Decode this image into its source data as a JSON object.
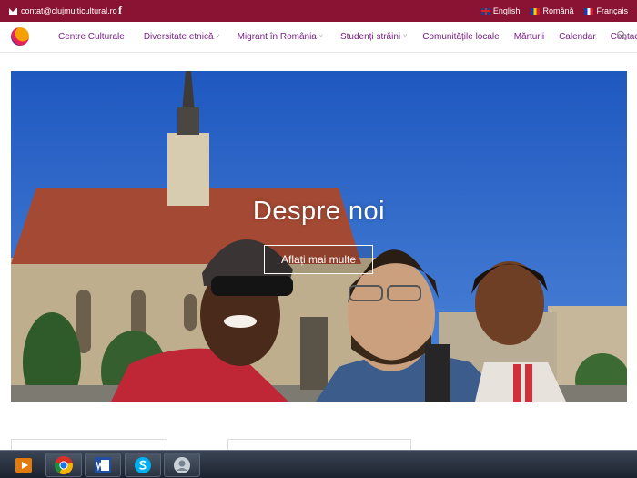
{
  "topbar": {
    "email": "contat@clujmulticultural.ro",
    "facebook": "f",
    "languages": [
      {
        "label": "English",
        "flag": "uk-flag-icon"
      },
      {
        "label": "Română",
        "flag": "romania-flag-icon"
      },
      {
        "label": "Français",
        "flag": "france-flag-icon"
      }
    ]
  },
  "nav": {
    "items": [
      {
        "label": "Centre Culturale",
        "dropdown": false
      },
      {
        "label": "Diversitate etnică",
        "dropdown": true
      },
      {
        "label": "Migrant în România",
        "dropdown": true
      },
      {
        "label": "Studenți străini",
        "dropdown": true
      },
      {
        "label": "Comunitățile locale",
        "dropdown": false
      },
      {
        "label": "Mărturii",
        "dropdown": false
      },
      {
        "label": "Calendar",
        "dropdown": false
      },
      {
        "label": "Contact",
        "dropdown": false
      }
    ],
    "caret": "˅"
  },
  "hero": {
    "title": "Despre noi",
    "button": "Aflați mai multe"
  },
  "taskbar": {
    "apps": [
      "media-player-icon",
      "chrome-icon",
      "word-icon",
      "skype-icon",
      "user-icon"
    ]
  },
  "colors": {
    "topbar": "#8a1232",
    "nav_text": "#7a1f86",
    "sky": "#2d63c4"
  }
}
